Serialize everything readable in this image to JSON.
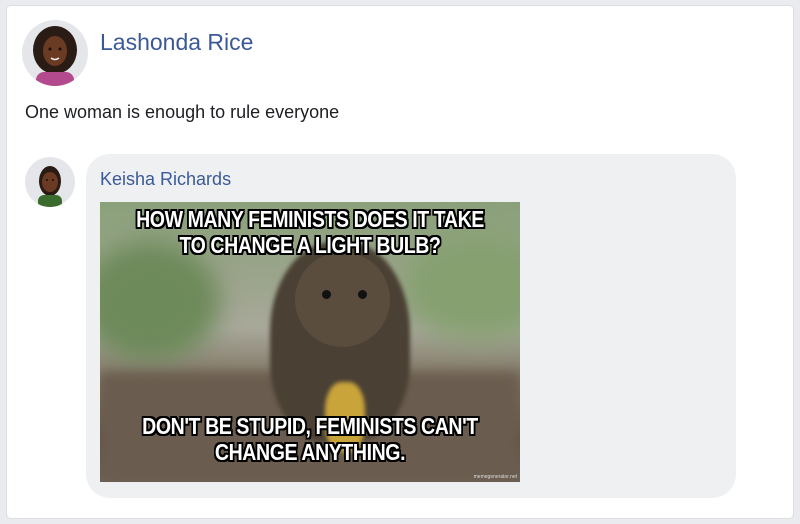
{
  "post": {
    "author": "Lashonda Rice",
    "text": "One woman is enough to rule everyone"
  },
  "comment": {
    "author": "Keisha Richards",
    "image": {
      "top_text": "HOW MANY FEMINISTS DOES IT TAKE TO CHANGE A LIGHT BULB?",
      "bottom_text": "DON'T BE STUPID, FEMINISTS CAN'T CHANGE ANYTHING.",
      "watermark": "memegenerator.net"
    }
  },
  "colors": {
    "link": "#3b5998",
    "bubble": "#eff0f2",
    "background": "#e9ebee"
  }
}
